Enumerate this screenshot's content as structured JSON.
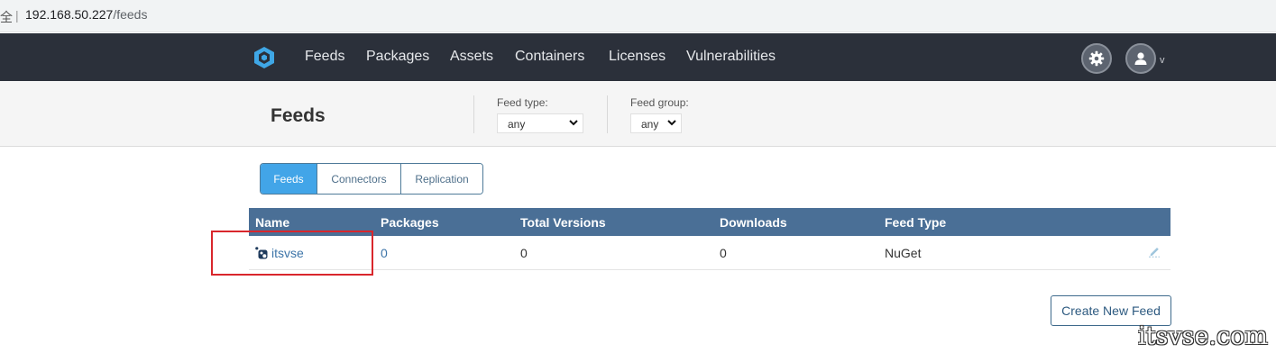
{
  "browser": {
    "lock_glyph": "全",
    "separator": "|",
    "url_host": "192.168.50.227",
    "url_path": "/feeds"
  },
  "nav": {
    "items": [
      "Feeds",
      "Packages",
      "Assets",
      "Containers",
      "Licenses",
      "Vulnerabilities"
    ],
    "user_caret": "v",
    "logo_icon": "proget-logo-icon",
    "settings_icon": "gear-icon",
    "user_icon": "user-avatar-icon"
  },
  "header": {
    "title": "Feeds",
    "feed_type_label": "Feed type:",
    "feed_type_value": "any",
    "feed_group_label": "Feed group:",
    "feed_group_value": "any"
  },
  "tabs": [
    {
      "label": "Feeds",
      "active": true
    },
    {
      "label": "Connectors",
      "active": false
    },
    {
      "label": "Replication",
      "active": false
    }
  ],
  "table": {
    "columns": [
      "Name",
      "Packages",
      "Total Versions",
      "Downloads",
      "Feed Type"
    ],
    "rows": [
      {
        "name": "itsvse",
        "packages": "0",
        "total_versions": "0",
        "downloads": "0",
        "feed_type": "NuGet"
      }
    ]
  },
  "actions": {
    "create_feed": "Create New Feed"
  },
  "watermark": "itsvse.com",
  "colors": {
    "nav_bg": "#2b303a",
    "table_header": "#4a6f96",
    "active_tab": "#42a5e8",
    "annotation": "#d9262c"
  }
}
